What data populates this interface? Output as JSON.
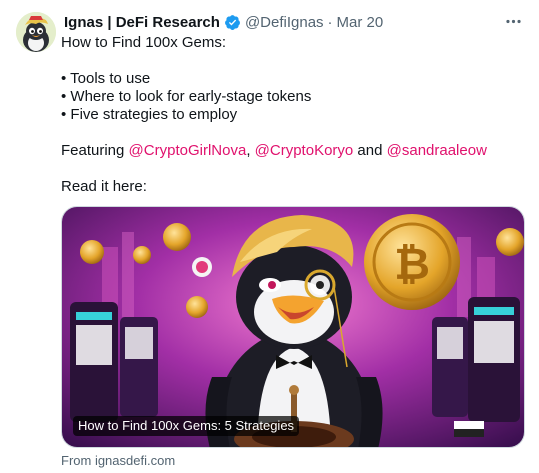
{
  "author": {
    "display_name": "Ignas | DeFi Research",
    "handle": "@DefiIgnas",
    "separator": "·",
    "date": "Mar 20",
    "verified_icon": "verified-badge-icon",
    "avatar_icon": "penguin-avatar"
  },
  "tweet": {
    "line1": "How to Find 100x Gems:",
    "bullets": [
      "• Tools to use",
      "• Where to look for early-stage tokens",
      "• Five strategies to employ"
    ],
    "featuring_prefix": "Featuring ",
    "mention1": "@CryptoGirlNova",
    "comma": ", ",
    "mention2": "@CryptoKoryo",
    "and_text": " and ",
    "mention3": "@sandraaleow",
    "read_it": "Read it here:"
  },
  "card": {
    "title": "How to Find 100x Gems: 5 Strategies",
    "source": "From ignasdefi.com"
  },
  "colors": {
    "mention": "#e0116d",
    "verified": "#1d9bf0",
    "muted": "#536471"
  }
}
